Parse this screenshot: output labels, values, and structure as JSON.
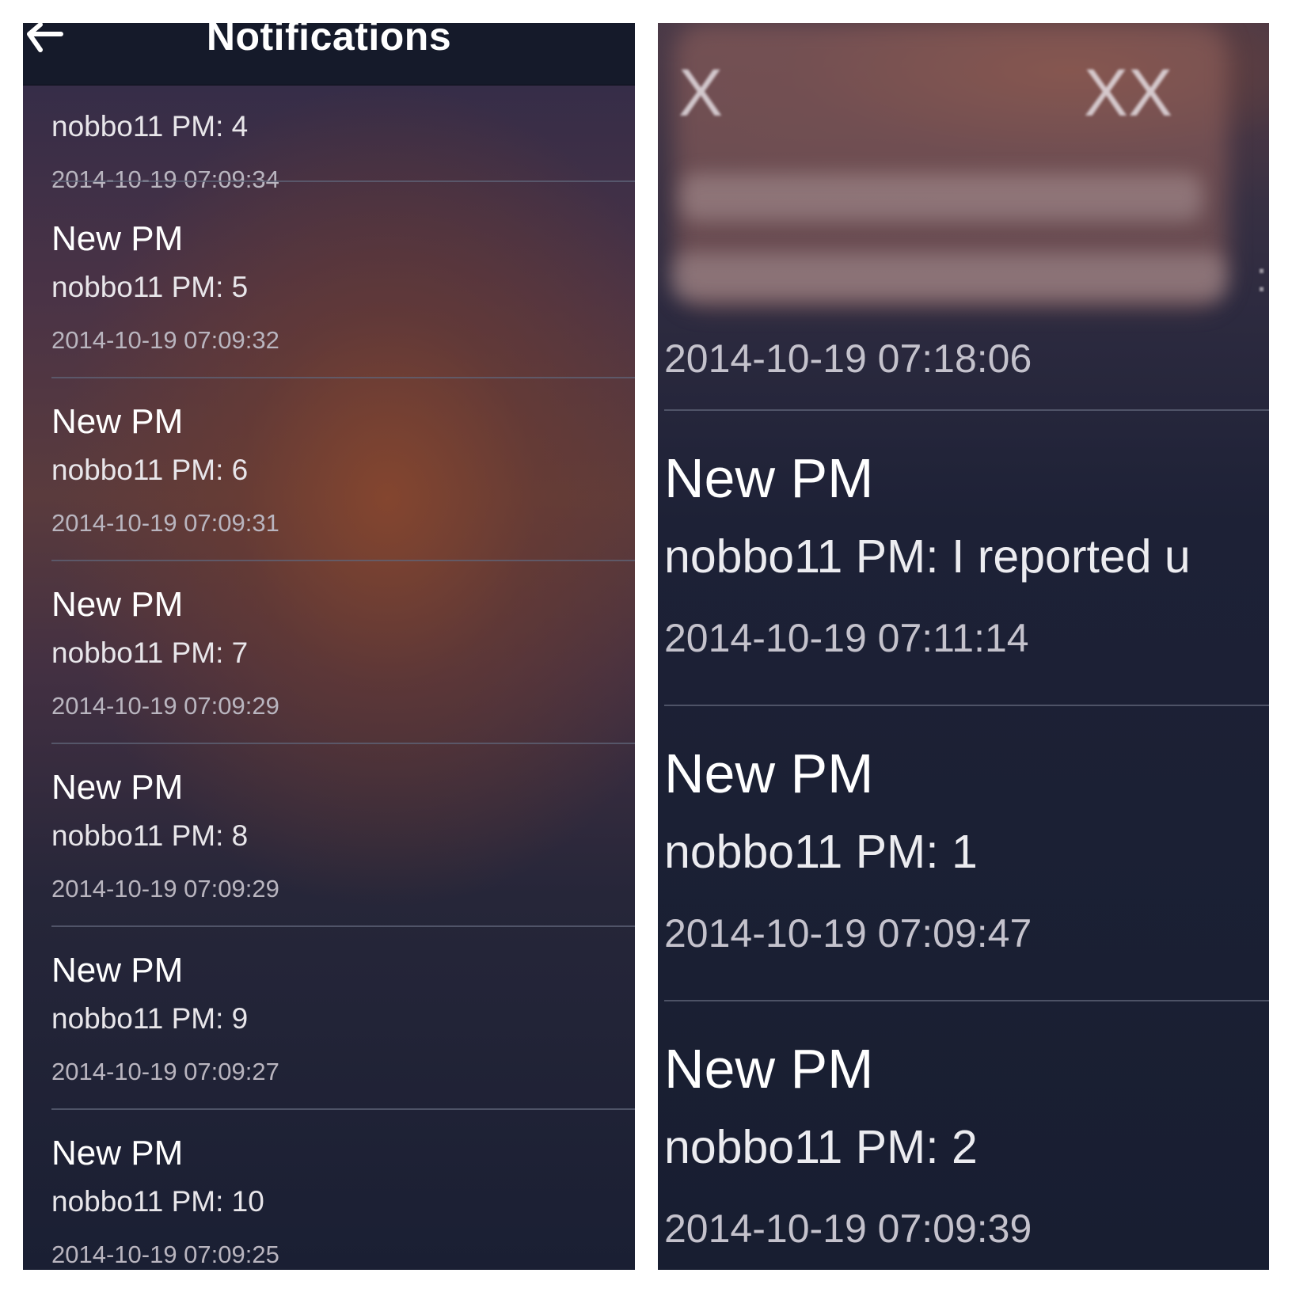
{
  "left": {
    "nav": {
      "title": "Notifications",
      "back_icon": "back-arrow-icon"
    },
    "partial_item": {
      "message": "nobbo11 PM: 4",
      "time": "2014-10-19 07:09:34"
    },
    "items": [
      {
        "title": "New PM",
        "message": "nobbo11 PM: 5",
        "time": "2014-10-19 07:09:32"
      },
      {
        "title": "New PM",
        "message": "nobbo11 PM: 6",
        "time": "2014-10-19 07:09:31"
      },
      {
        "title": "New PM",
        "message": "nobbo11 PM: 7",
        "time": "2014-10-19 07:09:29"
      },
      {
        "title": "New PM",
        "message": "nobbo11 PM: 8",
        "time": "2014-10-19 07:09:29"
      },
      {
        "title": "New PM",
        "message": "nobbo11 PM: 9",
        "time": "2014-10-19 07:09:27"
      },
      {
        "title": "New PM",
        "message": "nobbo11 PM: 10",
        "time": "2014-10-19 07:09:25"
      }
    ]
  },
  "right": {
    "redacted_item": {
      "marks_left": "X",
      "marks_right": "XX",
      "time": "2014-10-19 07:18:06"
    },
    "items": [
      {
        "title": "New PM",
        "message": "nobbo11 PM: I reported u",
        "time": "2014-10-19 07:11:14"
      },
      {
        "title": "New PM",
        "message": "nobbo11 PM: 1",
        "time": "2014-10-19 07:09:47"
      },
      {
        "title": "New PM",
        "message": "nobbo11 PM: 2",
        "time": "2014-10-19 07:09:39"
      }
    ]
  }
}
